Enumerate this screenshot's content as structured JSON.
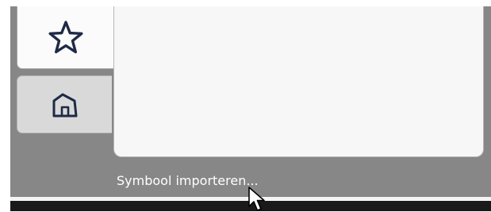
{
  "tabs": [
    {
      "name": "favorites",
      "icon": "star-icon",
      "selected": true
    },
    {
      "name": "home",
      "icon": "home-icon",
      "selected": false
    }
  ],
  "import_link": {
    "label": "Symbool importeren..."
  },
  "colors": {
    "panel_background": "#878787",
    "selected_tab": "#fbfbfb",
    "unselected_tab": "#d9d9d9",
    "content_panel": "#f7f7f7",
    "icon_stroke": "#1e2a46",
    "link_text": "#ffffff"
  }
}
